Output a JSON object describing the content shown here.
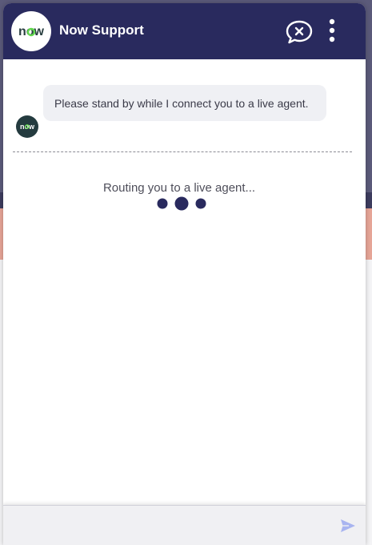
{
  "header": {
    "logo_text": "now",
    "title": "Now Support",
    "end_chat_icon": "chat-close-icon",
    "menu_icon": "more-vertical-icon"
  },
  "conversation": {
    "bot_avatar_text": "now",
    "bot_message": "Please stand by while I connect you to a live agent.",
    "routing_status": "Routing you to a live agent..."
  },
  "composer": {
    "input_value": "",
    "send_icon": "send-icon"
  },
  "colors": {
    "header_bg": "#292a5e",
    "accent": "#292a5e",
    "logo_green": "#62d84e",
    "bubble_bg": "#eff0f4",
    "send_disabled": "#a8b4f0"
  }
}
